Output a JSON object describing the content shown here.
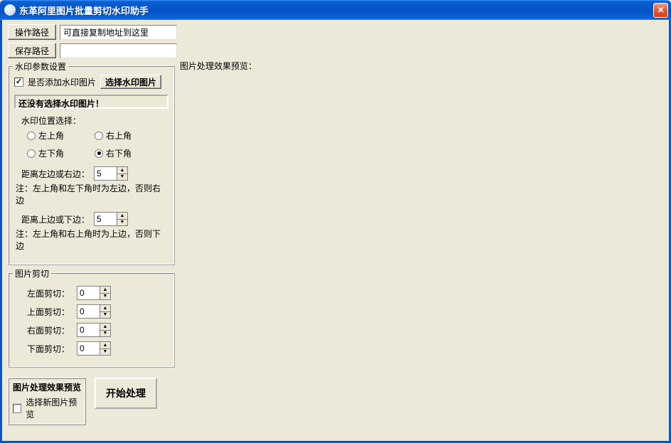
{
  "window": {
    "title": "东革阿里图片批量剪切水印助手"
  },
  "paths": {
    "op_label": "操作路径",
    "save_label": "保存路径",
    "op_value": "可直接复制地址到这里",
    "save_value": ""
  },
  "preview_label": "图片处理效果预览：",
  "watermark": {
    "group_title": "水印参数设置",
    "add_checkbox_label": "是否添加水印图片",
    "add_checked": true,
    "select_btn": "选择水印图片",
    "status_text": "还没有选择水印图片",
    "status_mark": "！",
    "position_label": "水印位置选择：",
    "positions": {
      "top_left": "左上角",
      "top_right": "右上角",
      "bottom_left": "左下角",
      "bottom_right": "右下角"
    },
    "selected_position": "bottom_right",
    "dist_h_label": "距离左边或右边：",
    "dist_h_value": "5",
    "dist_h_note": "注：左上角和左下角时为左边，否则右边",
    "dist_v_label": "距离上边或下边：",
    "dist_v_value": "5",
    "dist_v_note": "注：左上角和右上角时为上边，否则下边"
  },
  "crop": {
    "group_title": "图片剪切",
    "left_label": "左面剪切：",
    "top_label": "上面剪切：",
    "right_label": "右面剪切：",
    "bottom_label": "下面剪切：",
    "left_value": "0",
    "top_value": "0",
    "right_value": "0",
    "bottom_value": "0"
  },
  "actions": {
    "preview_header": "图片处理效果预览",
    "new_preview_label": "选择新图片预览",
    "new_preview_checked": false,
    "start_label": "开始处理"
  }
}
